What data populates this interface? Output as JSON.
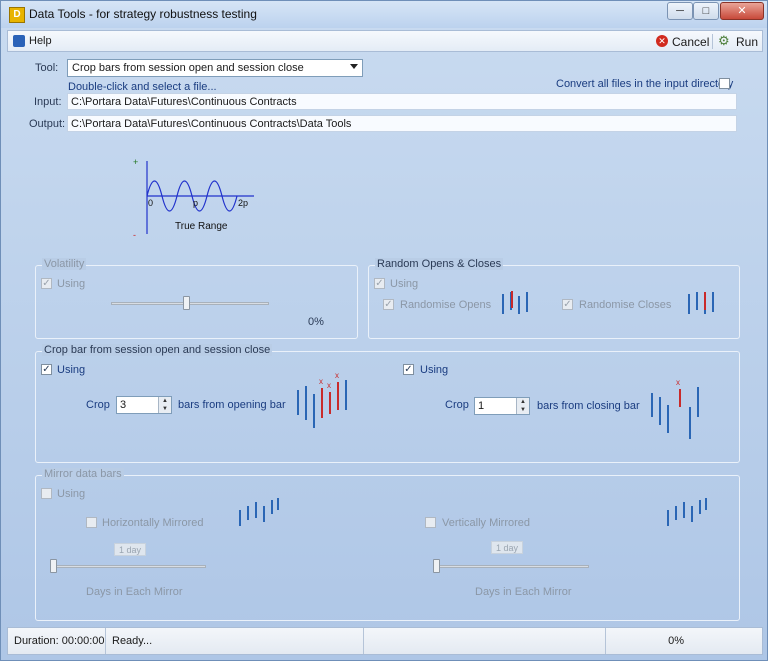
{
  "window": {
    "title": "Data Tools - for strategy robustness testing"
  },
  "menu": {
    "help": "Help",
    "cancel": "Cancel",
    "run": "Run"
  },
  "form": {
    "tool_label": "Tool:",
    "tool_value": "Crop bars from session open and session close",
    "hint": "Double-click and select a file...",
    "convert_all": "Convert all files in the input directory",
    "input_label": "Input:",
    "input_value": "C:\\Portara Data\\Futures\\Continuous Contracts",
    "output_label": "Output:",
    "output_value": "C:\\Portara Data\\Futures\\Continuous Contracts\\Data Tools"
  },
  "diagram": {
    "plus": "+",
    "minus": "-",
    "zero": "0",
    "p": "p",
    "twop": "2p",
    "caption": "True Range"
  },
  "volatility": {
    "title": "Volatility",
    "using": "Using",
    "value": "0%",
    "slider_fraction": 0.48
  },
  "random": {
    "title": "Random Opens & Closes",
    "using": "Using",
    "opens": "Randomise Opens",
    "closes": "Randomise Closes"
  },
  "crop": {
    "title": "Crop bar from session open and session close",
    "left_using": "Using",
    "crop_label": "Crop",
    "left_value": "3",
    "left_suffix": "bars from opening bar",
    "right_using": "Using",
    "right_crop_label": "Crop",
    "right_value": "1",
    "right_suffix": "bars from closing bar"
  },
  "mirror": {
    "title": "Mirror data bars",
    "using": "Using",
    "horizontal": "Horizontally Mirrored",
    "vertical": "Vertically Mirrored",
    "left_days": "1 day",
    "right_days": "1 day",
    "left_caption": "Days in Each Mirror",
    "right_caption": "Days in Each Mirror"
  },
  "status": {
    "duration_label": "Duration:",
    "duration": "00:00:00",
    "state": "Ready...",
    "progress": "0%"
  }
}
